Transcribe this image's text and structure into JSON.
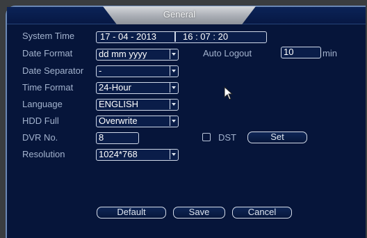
{
  "title": "General",
  "labels": {
    "system_time": "System Time",
    "date_format": "Date Format",
    "date_separator": "Date Separator",
    "time_format": "Time Format",
    "language": "Language",
    "hdd_full": "HDD Full",
    "dvr_no": "DVR No.",
    "resolution": "Resolution",
    "auto_logout": "Auto Logout",
    "min": "min",
    "dst": "DST"
  },
  "values": {
    "date": "17 - 04 - 2013",
    "time": "16 : 07 : 20",
    "date_format": "dd mm yyyy",
    "date_separator": "-",
    "time_format": "24-Hour",
    "language": "ENGLISH",
    "hdd_full": "Overwrite",
    "dvr_no": "8",
    "resolution": "1024*768",
    "auto_logout": "10",
    "dst_checked": false
  },
  "buttons": {
    "set": "Set",
    "default": "Default",
    "save": "Save",
    "cancel": "Cancel"
  },
  "icons": {
    "cursor": "mouse-pointer-icon",
    "dropdown": "chevron-down-icon"
  }
}
